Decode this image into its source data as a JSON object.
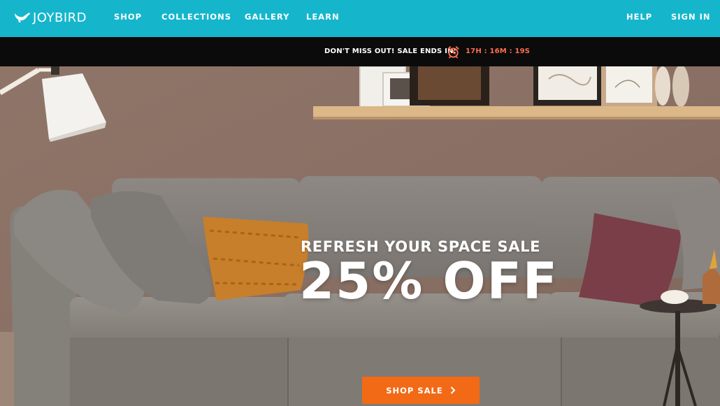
{
  "brand": {
    "name": "JOYBIRD"
  },
  "nav": {
    "shop": "SHOP",
    "collections": "COLLECTIONS",
    "gallery": "GALLERY",
    "learn": "LEARN",
    "help": "HELP",
    "sign_in": "SIGN IN"
  },
  "promo": {
    "message": "DON'T MISS OUT! SALE ENDS IN:",
    "countdown": "17H : 16M : 19S",
    "icon": "alarm-clock-icon"
  },
  "hero": {
    "subtitle": "REFRESH YOUR SPACE SALE",
    "title": "25% OFF",
    "cta_label": "SHOP SALE",
    "cta_icon": "chevron-right-icon"
  },
  "colors": {
    "nav_bg": "#15b6cc",
    "promo_bg": "#0b0b0b",
    "countdown": "#ff6f4e",
    "cta_bg": "#f26a15"
  }
}
